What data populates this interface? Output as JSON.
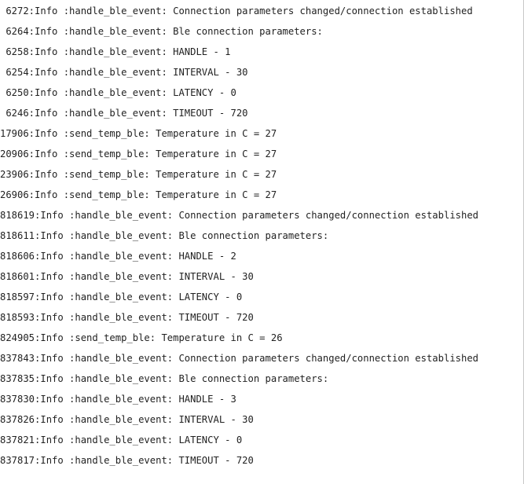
{
  "log": {
    "lines": [
      " 6272:Info :handle_ble_event: Connection parameters changed/connection established",
      " 6264:Info :handle_ble_event: Ble connection parameters:",
      " 6258:Info :handle_ble_event: HANDLE - 1",
      " 6254:Info :handle_ble_event: INTERVAL - 30",
      " 6250:Info :handle_ble_event: LATENCY - 0",
      " 6246:Info :handle_ble_event: TIMEOUT - 720",
      "17906:Info :send_temp_ble: Temperature in C = 27",
      "20906:Info :send_temp_ble: Temperature in C = 27",
      "23906:Info :send_temp_ble: Temperature in C = 27",
      "26906:Info :send_temp_ble: Temperature in C = 27",
      "818619:Info :handle_ble_event: Connection parameters changed/connection established",
      "818611:Info :handle_ble_event: Ble connection parameters:",
      "818606:Info :handle_ble_event: HANDLE - 2",
      "818601:Info :handle_ble_event: INTERVAL - 30",
      "818597:Info :handle_ble_event: LATENCY - 0",
      "818593:Info :handle_ble_event: TIMEOUT - 720",
      "824905:Info :send_temp_ble: Temperature in C = 26",
      "837843:Info :handle_ble_event: Connection parameters changed/connection established",
      "837835:Info :handle_ble_event: Ble connection parameters:",
      "837830:Info :handle_ble_event: HANDLE - 3",
      "837826:Info :handle_ble_event: INTERVAL - 30",
      "837821:Info :handle_ble_event: LATENCY - 0",
      "837817:Info :handle_ble_event: TIMEOUT - 720"
    ]
  }
}
